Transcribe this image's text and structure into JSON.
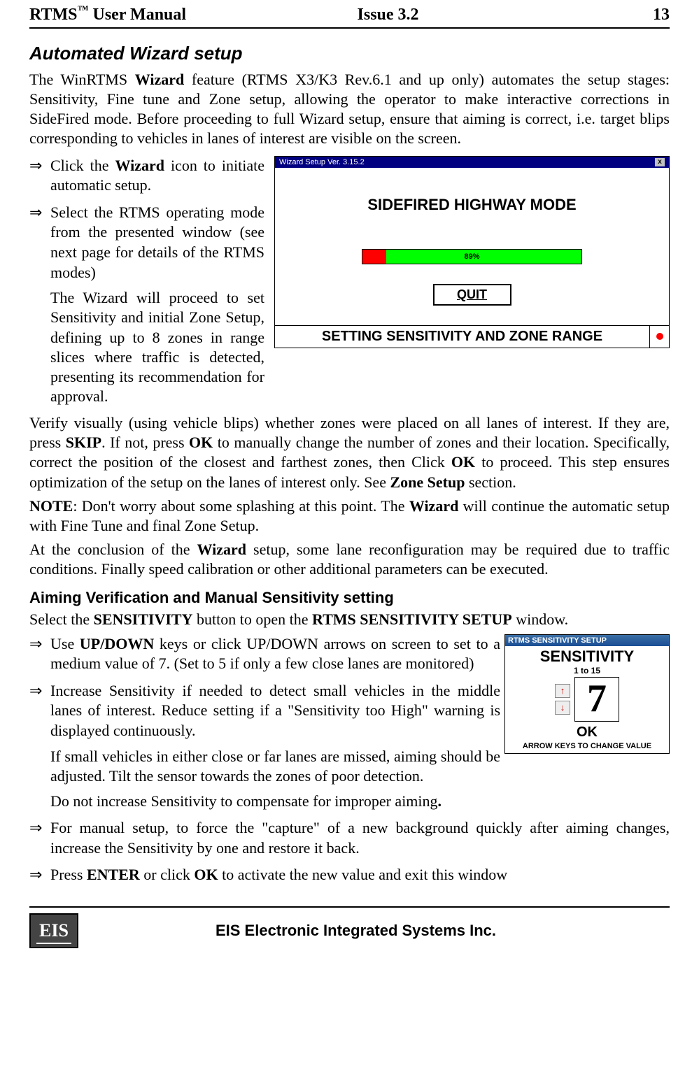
{
  "header": {
    "left_prefix": "RTMS",
    "left_tm": "™",
    "left_suffix": " User Manual",
    "center": "Issue 3.2",
    "right": "13"
  },
  "section1": {
    "title": "Automated Wizard setup",
    "intro_1": "The WinRTMS ",
    "intro_b1": "Wizard",
    "intro_2": " feature (RTMS X3/K3 Rev.6.1 and up only) automates the setup stages: Sensitivity, Fine tune and Zone setup, allowing the operator to make interactive corrections in SideFired mode. Before proceeding to full Wizard setup, ensure that aiming is correct, i.e. target blips corresponding to vehicles in lanes of interest are visible on the screen.",
    "bullets": [
      {
        "pre": "Click the ",
        "b": "Wizard",
        "post": " icon  to initiate automatic setup."
      },
      {
        "pre": "Select the RTMS operating mode from the presented window (see next page for details of the RTMS modes)",
        "b": "",
        "post": ""
      }
    ],
    "wizard_note": "The Wizard will proceed to set Sensitivity and initial Zone Setup, defining up to 8 zones in range slices where traffic is detected, presenting its recommendation for approval.",
    "verify_1": "Verify visually (using vehicle blips) whether zones were placed on all lanes of interest. If they are, press ",
    "verify_b1": "SKIP",
    "verify_2": ". If not, press ",
    "verify_b2": "OK",
    "verify_3": " to manually change the number of zones and their location. Specifically, correct the position of the closest and farthest zones, then Click ",
    "verify_b3": "OK",
    "verify_4": " to proceed. This step ensures optimization of the setup on the lanes of interest only. See ",
    "verify_b4": "Zone Setup",
    "verify_5": " section.",
    "note_b": "NOTE",
    "note_1": ": Don't worry about some splashing at this point. The ",
    "note_b2": "Wizard",
    "note_2": " will continue the automatic setup with Fine Tune and final Zone Setup.",
    "concl_1": "At the conclusion of the ",
    "concl_b": "Wizard",
    "concl_2": " setup, some lane reconfiguration may be required due to traffic conditions. Finally speed calibration or other additional parameters can be executed."
  },
  "figure1": {
    "title": "Wizard Setup Ver. 3.15.2",
    "heading": "SIDEFIRED HIGHWAY MODE",
    "progress": "89%",
    "quit": "QUIT",
    "footer": "SETTING SENSITIVITY AND ZONE RANGE",
    "close_x": "x"
  },
  "section2": {
    "title": "Aiming Verification and Manual Sensitivity setting",
    "opener_1": "Select the ",
    "opener_b1": "SENSITIVITY",
    "opener_2": " button to open the ",
    "opener_b2": "RTMS SENSITIVITY SETUP",
    "opener_3": " window.",
    "bullets": {
      "b1_pre": "Use ",
      "b1_b": "UP/DOWN",
      "b1_post": " keys or click UP/DOWN arrows on screen to set to a medium value of 7. (Set to 5 if only a few close lanes are monitored)",
      "b2": "Increase Sensitivity if needed to detect small vehicles in the middle lanes of interest. Reduce setting if  a \"Sensitivity too High\" warning is displayed continuously.",
      "b2_sub1": "If small vehicles in either close or far lanes are missed, aiming should be adjusted. Tilt the sensor towards the zones of poor detection.",
      "b2_sub2_pre": "Do not increase Sensitivity to compensate for improper aiming",
      "b2_sub2_b": ".",
      "b3": "For manual setup, to force the \"capture\" of a new background quickly after aiming changes, increase the Sensitivity by one and restore it back.",
      "b4_pre": "Press ",
      "b4_b1": "ENTER",
      "b4_mid": " or click ",
      "b4_b2": "OK",
      "b4_post": " to activate the new value and exit this window"
    }
  },
  "figure2": {
    "title": "RTMS SENSITIVITY SETUP",
    "heading": "SENSITIVITY",
    "range": "1 to 15",
    "value": "7",
    "ok": "OK",
    "footer": "ARROW KEYS TO CHANGE VALUE",
    "up": "↑",
    "down": "↓"
  },
  "footer": {
    "logo": "EIS",
    "text": "EIS Electronic Integrated Systems Inc."
  }
}
